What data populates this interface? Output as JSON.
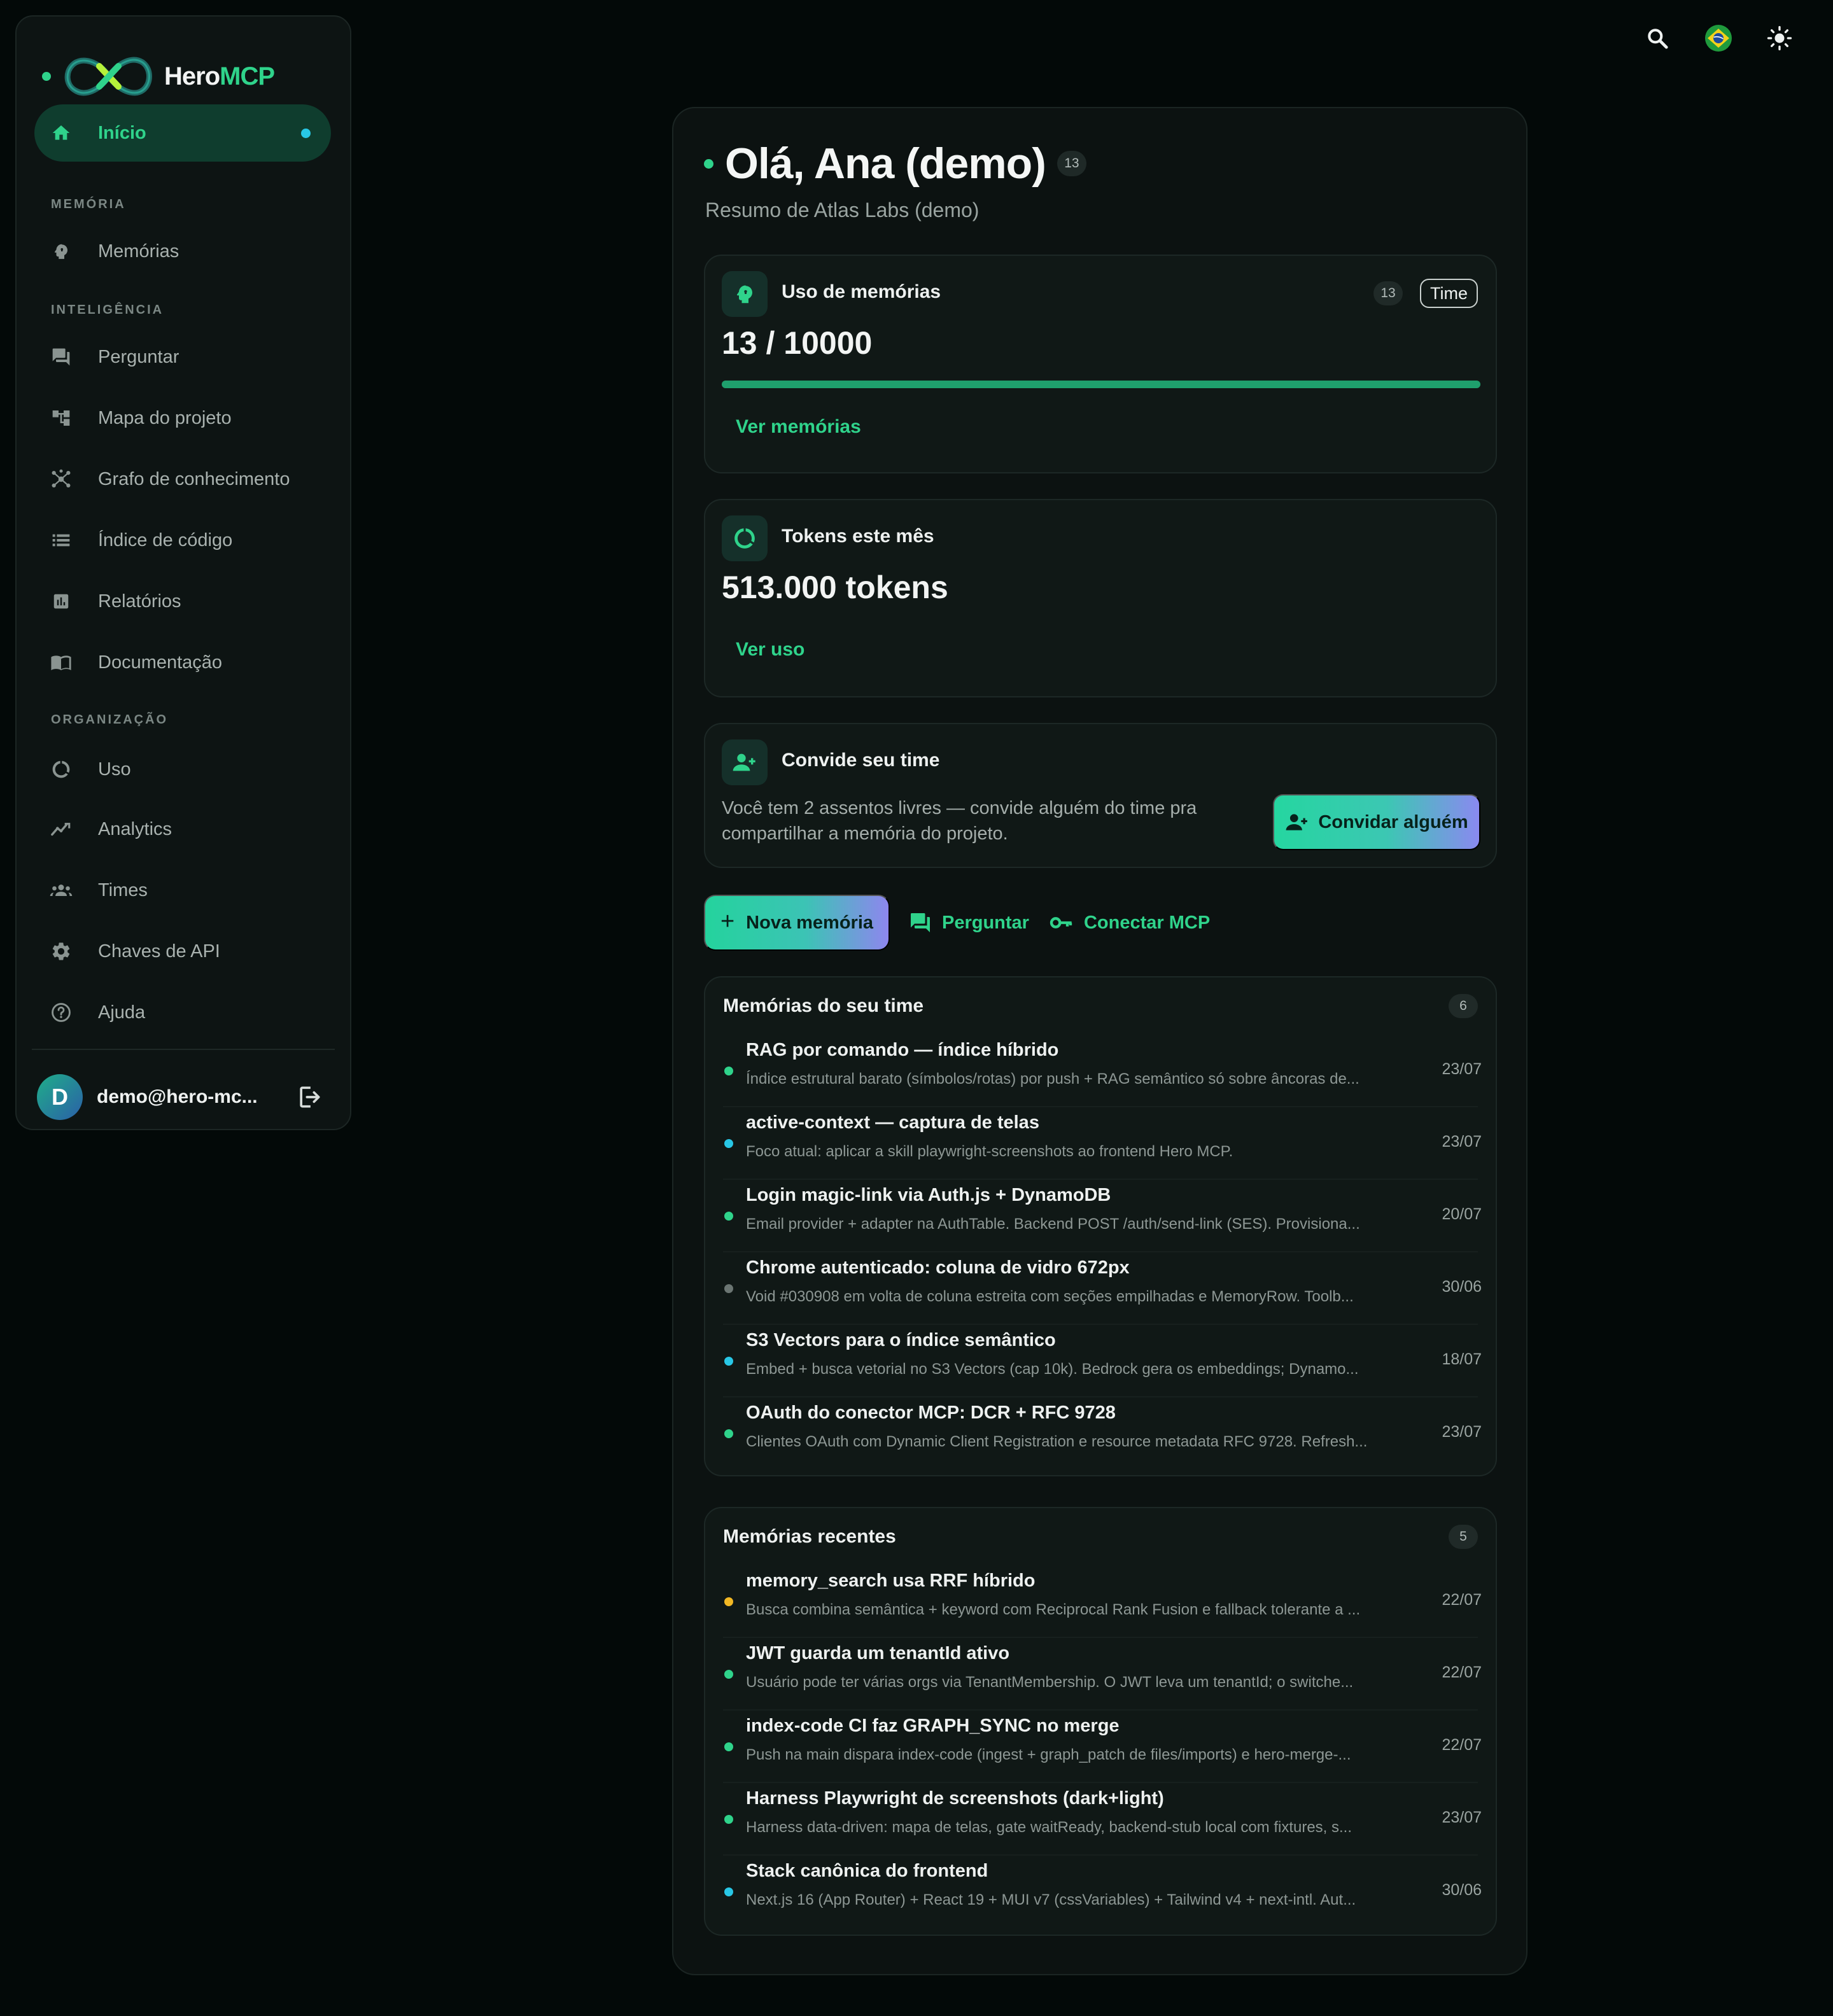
{
  "brand": {
    "name_prefix": "Hero",
    "name_suffix": "MCP"
  },
  "sidebar": {
    "active": {
      "label": "Início",
      "icon": "home-icon"
    },
    "sections": {
      "memoria": "MEMÓRIA",
      "inteligencia": "INTELIGÊNCIA",
      "organizacao": "ORGANIZAÇÃO"
    },
    "items": [
      {
        "label": "Memórias",
        "icon": "brain-icon"
      },
      {
        "label": "Perguntar",
        "icon": "chat-icon"
      },
      {
        "label": "Mapa do projeto",
        "icon": "tree-icon"
      },
      {
        "label": "Grafo de conhecimento",
        "icon": "graph-icon"
      },
      {
        "label": "Índice de código",
        "icon": "list-icon"
      },
      {
        "label": "Relatórios",
        "icon": "bar-chart-icon"
      },
      {
        "label": "Documentação",
        "icon": "book-icon"
      },
      {
        "label": "Uso",
        "icon": "donut-icon"
      },
      {
        "label": "Analytics",
        "icon": "trend-icon"
      },
      {
        "label": "Times",
        "icon": "group-icon"
      },
      {
        "label": "Chaves de API",
        "icon": "gear-icon"
      },
      {
        "label": "Ajuda",
        "icon": "help-icon"
      }
    ],
    "user": {
      "initial": "D",
      "email": "demo@hero-mc..."
    }
  },
  "topbar": {
    "icons": [
      "search-icon",
      "brazil-flag-icon",
      "sun-icon"
    ]
  },
  "main": {
    "greeting": "Olá, Ana (demo)",
    "greeting_count": "13",
    "subtitle": "Resumo de Atlas Labs (demo)",
    "memory_card": {
      "title": "Uso de memórias",
      "count": "13",
      "scope": "Time",
      "value": "13 / 10000",
      "progress_fraction": 1.0,
      "link": "Ver memórias"
    },
    "tokens_card": {
      "title": "Tokens este mês",
      "value": "513.000 tokens",
      "link": "Ver uso"
    },
    "invite_card": {
      "title": "Convide seu time",
      "text": "Você tem 2 assentos livres — convide alguém do time pra compartilhar a memória do projeto.",
      "button": "Convidar alguém"
    },
    "actions": {
      "new_memory": "Nova memória",
      "ask": "Perguntar",
      "connect": "Conectar MCP"
    },
    "team_memories": {
      "title": "Memórias do seu time",
      "count": "6",
      "items": [
        {
          "title": "RAG por comando — índice híbrido",
          "desc": "Índice estrutural barato (símbolos/rotas) por push + RAG semântico só sobre âncoras de...",
          "date": "23/07",
          "color": "#2fd38b"
        },
        {
          "title": "active-context — captura de telas",
          "desc": "Foco atual: aplicar a skill playwright-screenshots ao frontend Hero MCP.",
          "date": "23/07",
          "color": "#28c7e6"
        },
        {
          "title": "Login magic-link via Auth.js + DynamoDB",
          "desc": "Email provider + adapter na AuthTable. Backend POST /auth/send-link (SES). Provisiona...",
          "date": "20/07",
          "color": "#2fd38b"
        },
        {
          "title": "Chrome autenticado: coluna de vidro 672px",
          "desc": "Void #030908 em volta de coluna estreita com seções empilhadas e MemoryRow. Toolb...",
          "date": "30/06",
          "color": "#6b7572"
        },
        {
          "title": "S3 Vectors para o índice semântico",
          "desc": "Embed + busca vetorial no S3 Vectors (cap 10k). Bedrock gera os embeddings; Dynamo...",
          "date": "18/07",
          "color": "#28c7e6"
        },
        {
          "title": "OAuth do conector MCP: DCR + RFC 9728",
          "desc": "Clientes OAuth com Dynamic Client Registration e resource metadata RFC 9728. Refresh...",
          "date": "23/07",
          "color": "#2fd38b"
        }
      ]
    },
    "recent_memories": {
      "title": "Memórias recentes",
      "count": "5",
      "items": [
        {
          "title": "memory_search usa RRF híbrido",
          "desc": "Busca combina semântica + keyword com Reciprocal Rank Fusion e fallback tolerante a ...",
          "date": "22/07",
          "color": "#f2b824"
        },
        {
          "title": "JWT guarda um tenantId ativo",
          "desc": "Usuário pode ter várias orgs via TenantMembership. O JWT leva um tenantId; o switche...",
          "date": "22/07",
          "color": "#2fd38b"
        },
        {
          "title": "index-code CI faz GRAPH_SYNC no merge",
          "desc": "Push na main dispara index-code (ingest + graph_patch de files/imports) e hero-merge-...",
          "date": "22/07",
          "color": "#2fd38b"
        },
        {
          "title": "Harness Playwright de screenshots (dark+light)",
          "desc": "Harness data-driven: mapa de telas, gate waitReady, backend-stub local com fixtures, s...",
          "date": "23/07",
          "color": "#2fd38b"
        },
        {
          "title": "Stack canônica do frontend",
          "desc": "Next.js 16 (App Router) + React 19 + MUI v7 (cssVariables) + Tailwind v4 + next-intl. Aut...",
          "date": "30/06",
          "color": "#28c7e6"
        }
      ]
    }
  }
}
